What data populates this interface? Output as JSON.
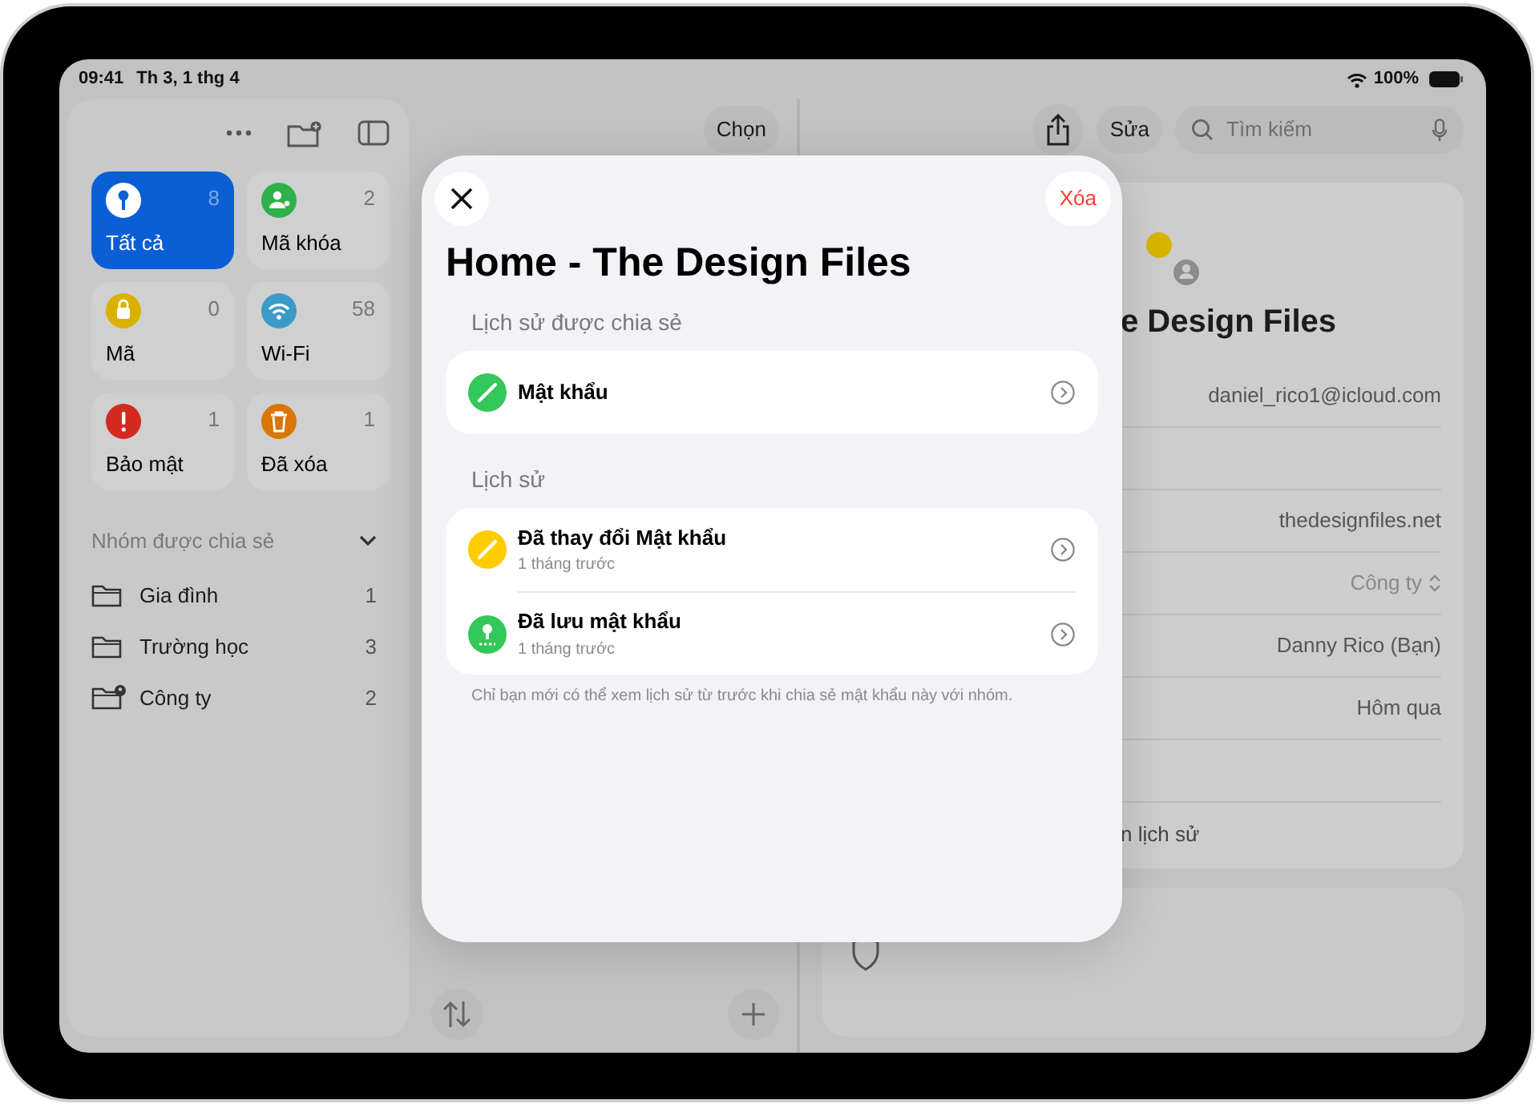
{
  "status_bar": {
    "time": "09:41",
    "date": "Th 3, 1 thg 4",
    "battery": "100%"
  },
  "sidebar": {
    "tiles": [
      {
        "label": "Tất cả",
        "count": "8",
        "selected": true,
        "color": "#0a5fd6"
      },
      {
        "label": "Mã khóa",
        "count": "2",
        "selected": false,
        "color": "#2fb14a"
      },
      {
        "label": "Mã",
        "count": "0",
        "selected": false,
        "color": "#d9b100"
      },
      {
        "label": "Wi-Fi",
        "count": "58",
        "selected": false,
        "color": "#3a9bc9"
      },
      {
        "label": "Bảo mật",
        "count": "1",
        "selected": false,
        "color": "#d42a20"
      },
      {
        "label": "Đã xóa",
        "count": "1",
        "selected": false,
        "color": "#d9760a"
      }
    ],
    "group_header": "Nhóm được chia sẻ",
    "group_expanded": true,
    "groups": [
      {
        "label": "Gia đình",
        "count": "1",
        "kind": "folder"
      },
      {
        "label": "Trường học",
        "count": "3",
        "kind": "folder"
      },
      {
        "label": "Công ty",
        "count": "2",
        "kind": "shared"
      }
    ]
  },
  "list_column": {
    "select_button": "Chọn"
  },
  "detail": {
    "edit_button": "Sửa",
    "search": {
      "placeholder": "Tìm kiếm"
    },
    "title": "e Design Files",
    "rows": [
      {
        "value": "daniel_rico1@icloud.com"
      },
      {
        "kind": "empty"
      },
      {
        "value": "thedesignfiles.net"
      },
      {
        "value": "Công ty",
        "kind": "picker"
      },
      {
        "value": "Danny Rico (Bạn)"
      },
      {
        "value": "Hôm qua"
      },
      {
        "kind": "empty"
      },
      {
        "value": "n lịch sử",
        "kind": "link"
      }
    ]
  },
  "modal": {
    "delete_button": "Xóa",
    "title": "Home - The Design Files",
    "sections": [
      {
        "header": "Lịch sử được chia sẻ",
        "items": [
          {
            "title": "Mật khẩu",
            "kind": "edit",
            "color": "#34c759"
          }
        ]
      },
      {
        "header": "Lịch sử",
        "items": [
          {
            "title": "Đã thay đổi Mật khẩu",
            "subtitle": "1 tháng trước",
            "kind": "edit",
            "color": "#ffcc00"
          },
          {
            "title": "Đã lưu mật khẩu",
            "subtitle": "1 tháng trước",
            "kind": "saved",
            "color": "#34c759"
          }
        ]
      }
    ],
    "footer": "Chỉ bạn mới có thể xem lịch sử từ trước khi chia sẻ mật khẩu này với nhóm."
  }
}
